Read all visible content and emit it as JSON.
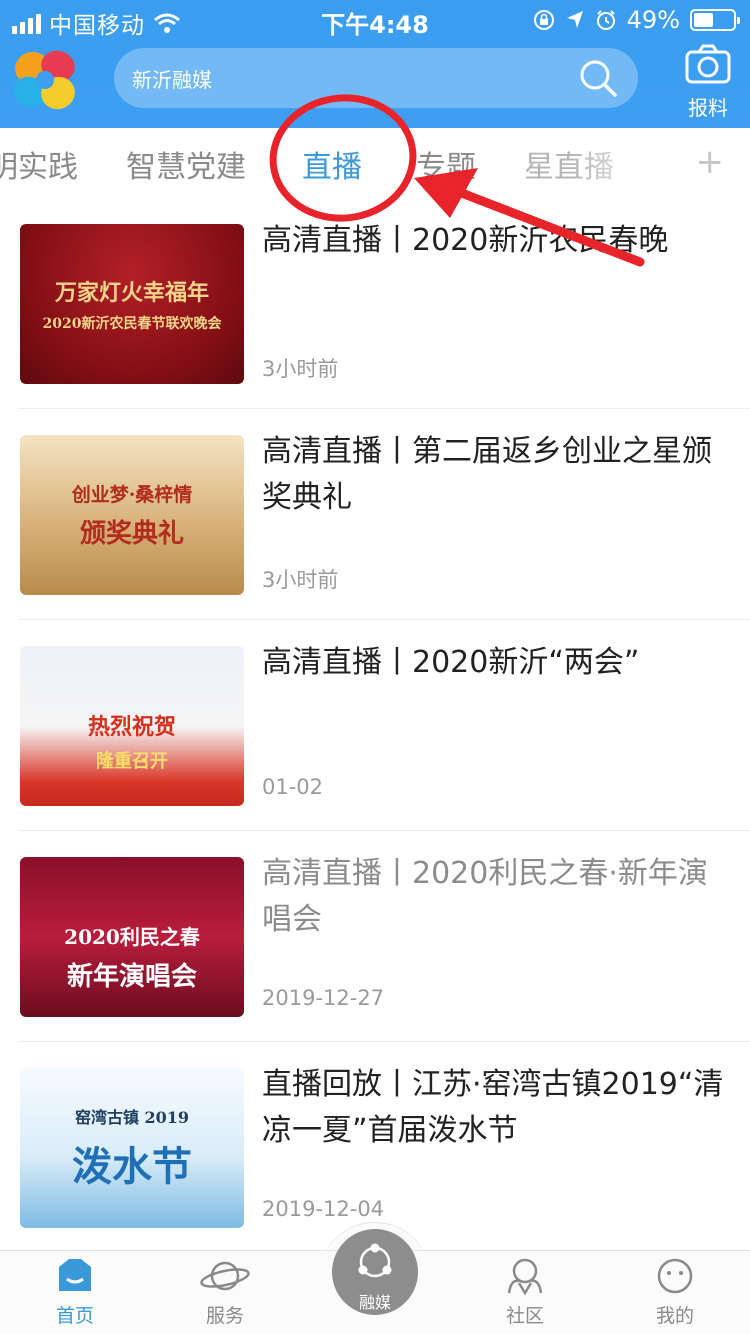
{
  "status_bar": {
    "carrier": "中国移动",
    "time": "下午4:48",
    "battery_percent": "49%",
    "battery_level": 0.49,
    "icons": [
      "signal-icon",
      "wifi-icon",
      "rotation-lock-icon",
      "location-icon",
      "alarm-icon",
      "battery-icon"
    ]
  },
  "header": {
    "search_placeholder": "新沂融媒",
    "report_label": "报料",
    "colors": {
      "bar": "#3e9ff2"
    }
  },
  "tabs": {
    "items": [
      {
        "label": "明实践"
      },
      {
        "label": "智慧党建"
      },
      {
        "label": "直播",
        "active": true
      },
      {
        "label": "专题"
      },
      {
        "label": "星直播"
      }
    ],
    "add_icon": "plus-icon",
    "active_color": "#3a9ad9"
  },
  "articles": [
    {
      "title": "高清直播丨2020新沂农民春晚",
      "time": "3小时前",
      "thumb": {
        "line1": "万家灯火幸福年",
        "line2": "2020新沂农民春节联欢晚会"
      }
    },
    {
      "title": "高清直播丨第二届返乡创业之星颁奖典礼",
      "time": "3小时前",
      "thumb": {
        "line1": "创业梦·桑梓情",
        "line2": "颁奖典礼"
      }
    },
    {
      "title": "高清直播丨2020新沂“两会”",
      "time": "01-02",
      "thumb": {
        "line1": "热烈祝贺",
        "line2": "隆重召开"
      }
    },
    {
      "title": "高清直播丨2020利民之春·新年演唱会",
      "time": "2019-12-27",
      "thumb": {
        "line1": "2020利民之春",
        "line2": "新年演唱会"
      }
    },
    {
      "title": "直播回放丨江苏·窑湾古镇2019“清凉一夏”首届泼水节",
      "time": "2019-12-04",
      "thumb": {
        "line1": "窑湾古镇 2019",
        "line2": "泼水节"
      }
    }
  ],
  "bottom_nav": {
    "items": [
      {
        "label": "首页",
        "icon": "home-icon",
        "active": true
      },
      {
        "label": "服务",
        "icon": "planet-icon"
      },
      {
        "label": "融媒",
        "icon": "share-hub-icon"
      },
      {
        "label": "社区",
        "icon": "community-icon"
      },
      {
        "label": "我的",
        "icon": "smiley-icon"
      }
    ]
  },
  "annotation": {
    "color": "#e8242b"
  }
}
